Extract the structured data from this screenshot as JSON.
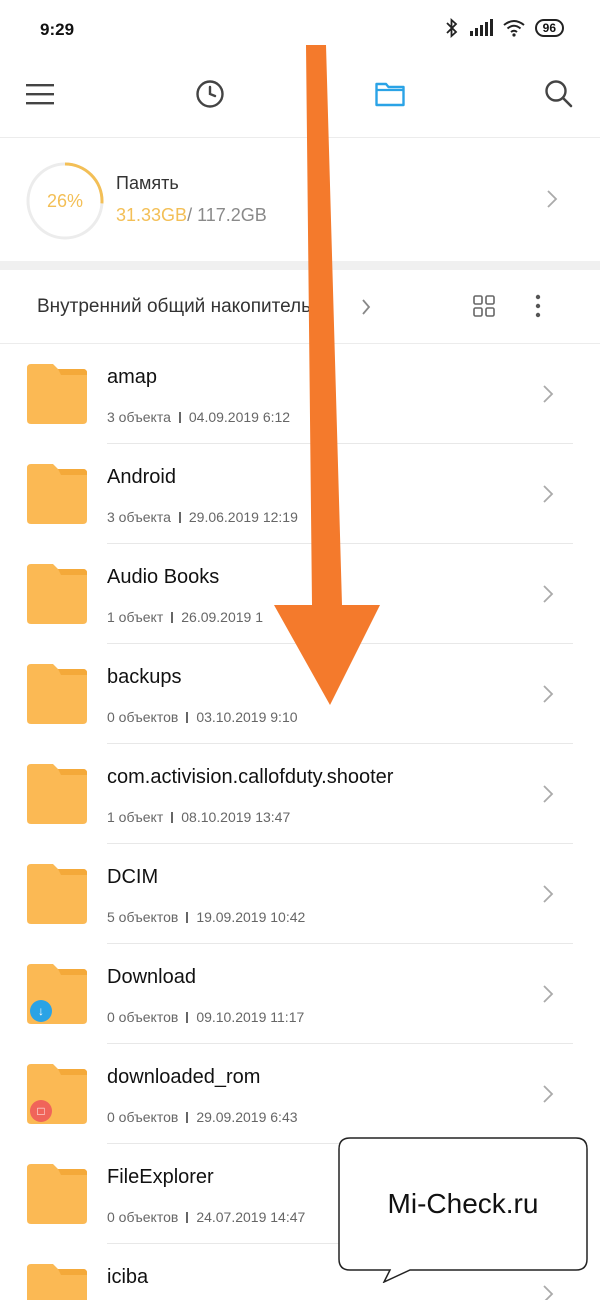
{
  "status_bar": {
    "time": "9:29",
    "battery": "96"
  },
  "toolbar": {
    "icons": [
      "menu-icon",
      "clock-icon",
      "folder-icon",
      "search-icon"
    ],
    "active_color": "#2aa3e6"
  },
  "storage": {
    "percent_label": "26%",
    "percent_value": 0.26,
    "title": "Память",
    "used": "31.33GB",
    "total": "/ 117.2GB",
    "accent": "#f3bf56"
  },
  "path": {
    "label": "Внутренний общий накопитель"
  },
  "files": [
    {
      "name": "amap",
      "count": "3 объекта",
      "date": "04.09.2019 6:12",
      "badge": null
    },
    {
      "name": "Android",
      "count": "3 объекта",
      "date": "29.06.2019 12:19",
      "badge": null
    },
    {
      "name": "Audio Books",
      "count": "1 объект",
      "date": "26.09.2019 1",
      "badge": null
    },
    {
      "name": "backups",
      "count": "0 объектов",
      "date": "03.10.2019 9:10",
      "badge": null
    },
    {
      "name": "com.activision.callofduty.shooter",
      "count": "1 объект",
      "date": "08.10.2019 13:47",
      "badge": null
    },
    {
      "name": "DCIM",
      "count": "5 объектов",
      "date": "19.09.2019 10:42",
      "badge": null
    },
    {
      "name": "Download",
      "count": "0 объектов",
      "date": "09.10.2019 11:17",
      "badge": "download"
    },
    {
      "name": "downloaded_rom",
      "count": "0 объектов",
      "date": "29.09.2019 6:43",
      "badge": "package"
    },
    {
      "name": "FileExplorer",
      "count": "0 объектов",
      "date": "24.07.2019 14:47",
      "badge": null
    },
    {
      "name": "iciba",
      "count": "",
      "date": "",
      "badge": null
    }
  ],
  "colors": {
    "folder": "#fbb954",
    "folder_tab": "#f4a93a",
    "arrow": "#f47a2c"
  },
  "watermark": {
    "text": "Mi-Check.ru"
  }
}
